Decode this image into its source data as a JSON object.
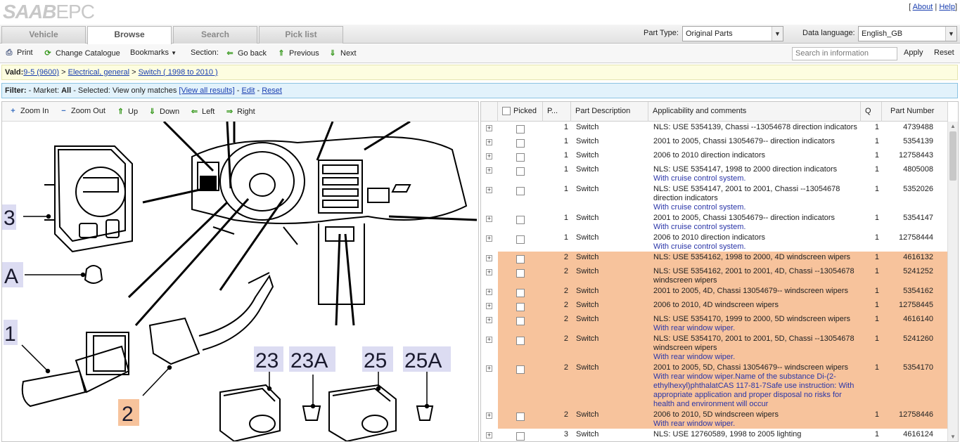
{
  "header": {
    "logo_brand": "SAAB",
    "logo_app": "EPC",
    "about": "About",
    "help": "Help"
  },
  "tabs": [
    {
      "label": "Vehicle"
    },
    {
      "label": "Browse"
    },
    {
      "label": "Search"
    },
    {
      "label": "Pick list"
    }
  ],
  "part_type": {
    "label": "Part Type:",
    "value": "Original Parts"
  },
  "data_language": {
    "label": "Data language:",
    "value": "English_GB"
  },
  "toolbar": {
    "print": "Print",
    "change_catalogue": "Change Catalogue",
    "bookmarks": "Bookmarks",
    "section": "Section:",
    "go_back": "Go back",
    "previous": "Previous",
    "next": "Next",
    "search_placeholder": "Search in information",
    "apply": "Apply",
    "reset": "Reset"
  },
  "vald": {
    "label": "Vald:",
    "crumb1": "9-5 (9600)",
    "sep1": " > ",
    "crumb2": "Electrical, general",
    "sep2": " > ",
    "crumb3": "Switch ( 1998 to 2010 )"
  },
  "filter": {
    "label": "Filter:",
    "market_prefix": " - Market: ",
    "market": "All",
    "selected_prefix": " - Selected: ",
    "selected": "View only matches",
    "view_all": "[View all results]",
    "edit": "Edit",
    "reset": "Reset"
  },
  "zoom": {
    "zoom_in": "Zoom In",
    "zoom_out": "Zoom Out",
    "up": "Up",
    "down": "Down",
    "left": "Left",
    "right": "Right"
  },
  "diagram_labels": {
    "l3": "3",
    "lA": "A",
    "l1": "1",
    "l2": "2",
    "l23": "23",
    "l23A": "23A",
    "l25": "25",
    "l25A": "25A"
  },
  "table": {
    "headers": {
      "picked": "Picked",
      "pos": "P...",
      "part_description": "Part Description",
      "applicability": "Applicability and comments",
      "qty": "Q",
      "part_number": "Part Number"
    },
    "rows": [
      {
        "pos": "1",
        "desc": "Switch",
        "appl": "NLS: USE 5354139, Chassi --13054678 direction indicators",
        "comment": "",
        "qty": "1",
        "pn": "4739488"
      },
      {
        "pos": "1",
        "desc": "Switch",
        "appl": "2001 to 2005, Chassi 13054679-- direction indicators",
        "comment": "",
        "qty": "1",
        "pn": "5354139"
      },
      {
        "pos": "1",
        "desc": "Switch",
        "appl": "2006 to 2010 direction indicators",
        "comment": "",
        "qty": "1",
        "pn": "12758443"
      },
      {
        "pos": "1",
        "desc": "Switch",
        "appl": "NLS: USE 5354147, 1998 to 2000 direction indicators",
        "comment": "With cruise control system.",
        "qty": "1",
        "pn": "4805008"
      },
      {
        "pos": "1",
        "desc": "Switch",
        "appl": "NLS: USE 5354147, 2001 to 2001, Chassi --13054678 direction indicators",
        "comment": "With cruise control system.",
        "qty": "1",
        "pn": "5352026"
      },
      {
        "pos": "1",
        "desc": "Switch",
        "appl": "2001 to 2005, Chassi 13054679-- direction indicators",
        "comment": "With cruise control system.",
        "qty": "1",
        "pn": "5354147"
      },
      {
        "pos": "1",
        "desc": "Switch",
        "appl": "2006 to 2010 direction indicators",
        "comment": "With cruise control system.",
        "qty": "1",
        "pn": "12758444"
      },
      {
        "pos": "2",
        "desc": "Switch",
        "appl": "NLS: USE 5354162, 1998 to 2000, 4D windscreen wipers",
        "comment": "",
        "qty": "1",
        "pn": "4616132"
      },
      {
        "pos": "2",
        "desc": "Switch",
        "appl": "NLS: USE 5354162, 2001 to 2001, 4D, Chassi --13054678 windscreen wipers",
        "comment": "",
        "qty": "1",
        "pn": "5241252"
      },
      {
        "pos": "2",
        "desc": "Switch",
        "appl": "2001 to 2005, 4D, Chassi 13054679-- windscreen wipers",
        "comment": "",
        "qty": "1",
        "pn": "5354162"
      },
      {
        "pos": "2",
        "desc": "Switch",
        "appl": "2006 to 2010, 4D windscreen wipers",
        "comment": "",
        "qty": "1",
        "pn": "12758445"
      },
      {
        "pos": "2",
        "desc": "Switch",
        "appl": "NLS: USE 5354170, 1999 to 2000, 5D windscreen wipers",
        "comment": "With rear window wiper.",
        "qty": "1",
        "pn": "4616140"
      },
      {
        "pos": "2",
        "desc": "Switch",
        "appl": "NLS: USE 5354170, 2001 to 2001, 5D, Chassi --13054678 windscreen wipers",
        "comment": "With rear window wiper.",
        "qty": "1",
        "pn": "5241260"
      },
      {
        "pos": "2",
        "desc": "Switch",
        "appl": "2001 to 2005, 5D, Chassi 13054679-- windscreen wipers",
        "comment": "With rear window wiper.Name of the substance Di-(2-ethylhexyl)phthalatCAS 117-81-7Safe use instruction: With appropriate application and proper disposal no risks for health and environment will occur",
        "qty": "1",
        "pn": "5354170"
      },
      {
        "pos": "2",
        "desc": "Switch",
        "appl": "2006 to 2010, 5D windscreen wipers",
        "comment": "With rear window wiper.",
        "qty": "1",
        "pn": "12758446"
      },
      {
        "pos": "3",
        "desc": "Switch",
        "appl": "NLS: USE 12760589, 1998 to 2005 lighting",
        "comment": "",
        "qty": "1",
        "pn": "4616124"
      }
    ]
  },
  "colors": {
    "highlight_row": "#f7c39c",
    "vald_bg": "#fdfde0",
    "filter_bg": "#e2f2fb",
    "link": "#1a3fb0",
    "comment": "#2a35a8"
  }
}
